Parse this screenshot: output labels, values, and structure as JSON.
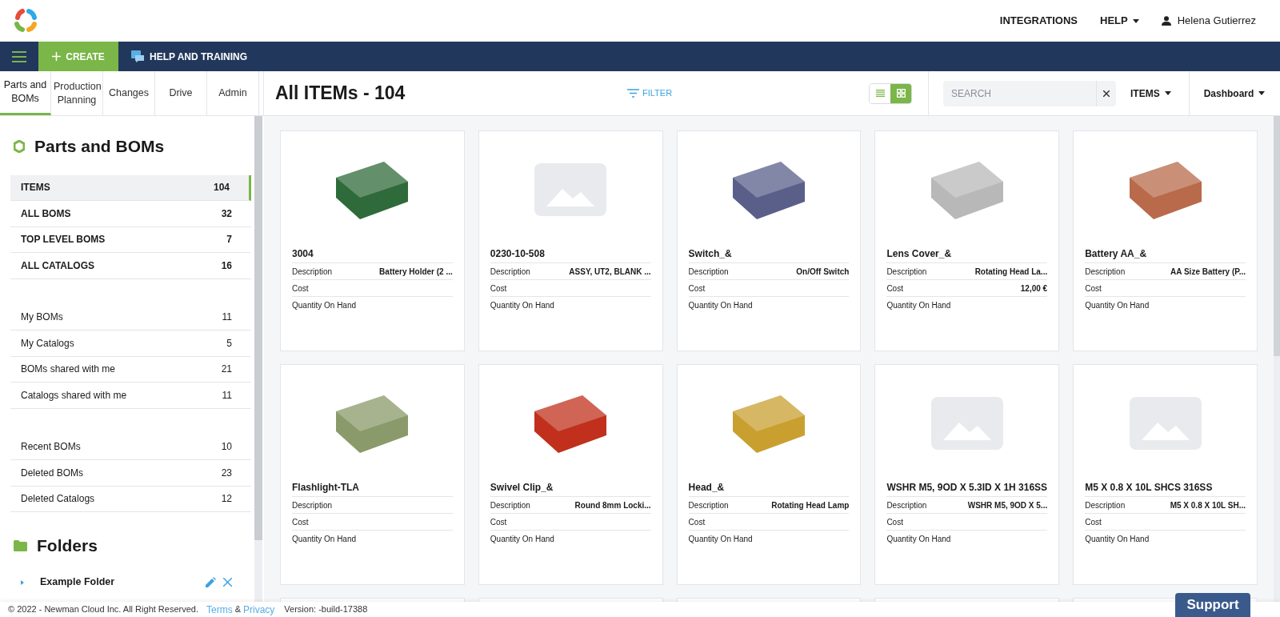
{
  "header": {
    "links": [
      {
        "label": "INTEGRATIONS",
        "kind": "link"
      },
      {
        "label": "HELP",
        "kind": "dropdown"
      }
    ],
    "user": "Helena Gutierrez"
  },
  "navbar": {
    "create": "CREATE",
    "help_training": "HELP AND TRAINING"
  },
  "module_tabs": [
    {
      "label": "Parts and BOMs",
      "selected": true
    },
    {
      "label": "Production Planning",
      "selected": false
    },
    {
      "label": "Changes",
      "selected": false
    },
    {
      "label": "Drive",
      "selected": false
    },
    {
      "label": "Admin",
      "selected": false
    }
  ],
  "page_title": "All ITEMs - 104",
  "filter": "FILTER",
  "view_toggle": [
    {
      "kind": "list",
      "selected": false
    },
    {
      "kind": "grid",
      "selected": true
    }
  ],
  "search": {
    "placeholder": "SEARCH"
  },
  "items_menu": "ITEMS",
  "dashboard_menu": "Dashboard",
  "sidebar": {
    "title": "Parts and BOMs",
    "groups": [
      [
        {
          "label": "ITEMS",
          "count": "104",
          "selected": true,
          "bold": true
        },
        {
          "label": "ALL BOMS",
          "count": "32",
          "selected": false,
          "bold": true
        },
        {
          "label": "TOP LEVEL BOMS",
          "count": "7",
          "selected": false,
          "bold": true
        },
        {
          "label": "ALL CATALOGS",
          "count": "16",
          "selected": false,
          "bold": true
        }
      ],
      [
        {
          "label": "My BOMs",
          "count": "11",
          "selected": false,
          "bold": false
        },
        {
          "label": "My Catalogs",
          "count": "5",
          "selected": false,
          "bold": false
        },
        {
          "label": "BOMs shared with me",
          "count": "21",
          "selected": false,
          "bold": false
        },
        {
          "label": "Catalogs shared with me",
          "count": "11",
          "selected": false,
          "bold": false
        }
      ],
      [
        {
          "label": "Recent BOMs",
          "count": "10",
          "selected": false,
          "bold": false
        },
        {
          "label": "Deleted BOMs",
          "count": "23",
          "selected": false,
          "bold": false
        },
        {
          "label": "Deleted Catalogs",
          "count": "12",
          "selected": false,
          "bold": false
        }
      ]
    ],
    "folders_title": "Folders",
    "folders": [
      {
        "label": "Example Folder",
        "expanded": false
      }
    ]
  },
  "cards": [
    {
      "title": "3004",
      "kind": "render",
      "color": "#2f6b3a",
      "fields": [
        {
          "label": "Description",
          "value": "Battery Holder (2 ..."
        },
        {
          "label": "Cost"
        },
        {
          "label": "Quantity On Hand"
        }
      ]
    },
    {
      "title": "0230-10-508",
      "kind": "placeholder",
      "fields": [
        {
          "label": "Description",
          "value": "ASSY, UT2, BLANK ..."
        },
        {
          "label": "Cost"
        },
        {
          "label": "Quantity On Hand"
        }
      ]
    },
    {
      "title": "Switch_&",
      "kind": "render",
      "color": "#5a5f8a",
      "fields": [
        {
          "label": "Description",
          "value": "On/Off Switch"
        },
        {
          "label": "Cost"
        },
        {
          "label": "Quantity On Hand"
        }
      ]
    },
    {
      "title": "Lens Cover_&",
      "kind": "render",
      "color": "#b8b8b8",
      "fields": [
        {
          "label": "Description",
          "value": "Rotating Head La..."
        },
        {
          "label": "Cost",
          "value": "12,00 €"
        },
        {
          "label": "Quantity On Hand"
        }
      ]
    },
    {
      "title": "Battery AA_&",
      "kind": "render",
      "color": "#b86a4a",
      "fields": [
        {
          "label": "Description",
          "value": "AA Size Battery (P..."
        },
        {
          "label": "Cost"
        },
        {
          "label": "Quantity On Hand"
        }
      ]
    },
    {
      "title": "Flashlight-TLA",
      "kind": "render",
      "color": "#8a9a6a",
      "fields": [
        {
          "label": "Description"
        },
        {
          "label": "Cost"
        },
        {
          "label": "Quantity On Hand"
        }
      ]
    },
    {
      "title": "Swivel Clip_&",
      "kind": "render",
      "color": "#c0301c",
      "fields": [
        {
          "label": "Description",
          "value": "Round 8mm Locki..."
        },
        {
          "label": "Cost"
        },
        {
          "label": "Quantity On Hand"
        }
      ]
    },
    {
      "title": "Head_&",
      "kind": "render",
      "color": "#c9a030",
      "fields": [
        {
          "label": "Description",
          "value": "Rotating Head Lamp"
        },
        {
          "label": "Cost"
        },
        {
          "label": "Quantity On Hand"
        }
      ]
    },
    {
      "title": "WSHR M5, 9OD X 5.3ID X 1H 316SS",
      "kind": "placeholder",
      "fields": [
        {
          "label": "Description",
          "value": "WSHR M5, 9OD X 5..."
        },
        {
          "label": "Cost"
        },
        {
          "label": "Quantity On Hand"
        }
      ]
    },
    {
      "title": "M5 X 0.8 X 10L SHCS 316SS",
      "kind": "placeholder",
      "fields": [
        {
          "label": "Description",
          "value": "M5 X 0.8 X 10L SH..."
        },
        {
          "label": "Cost"
        },
        {
          "label": "Quantity On Hand"
        }
      ]
    }
  ],
  "footer": {
    "copyright": "© 2022 - Newman Cloud Inc. All Right Reserved.",
    "terms": "Terms",
    "and": "&",
    "privacy": "Privacy",
    "version": "Version: -build-17388"
  },
  "support": "Support"
}
